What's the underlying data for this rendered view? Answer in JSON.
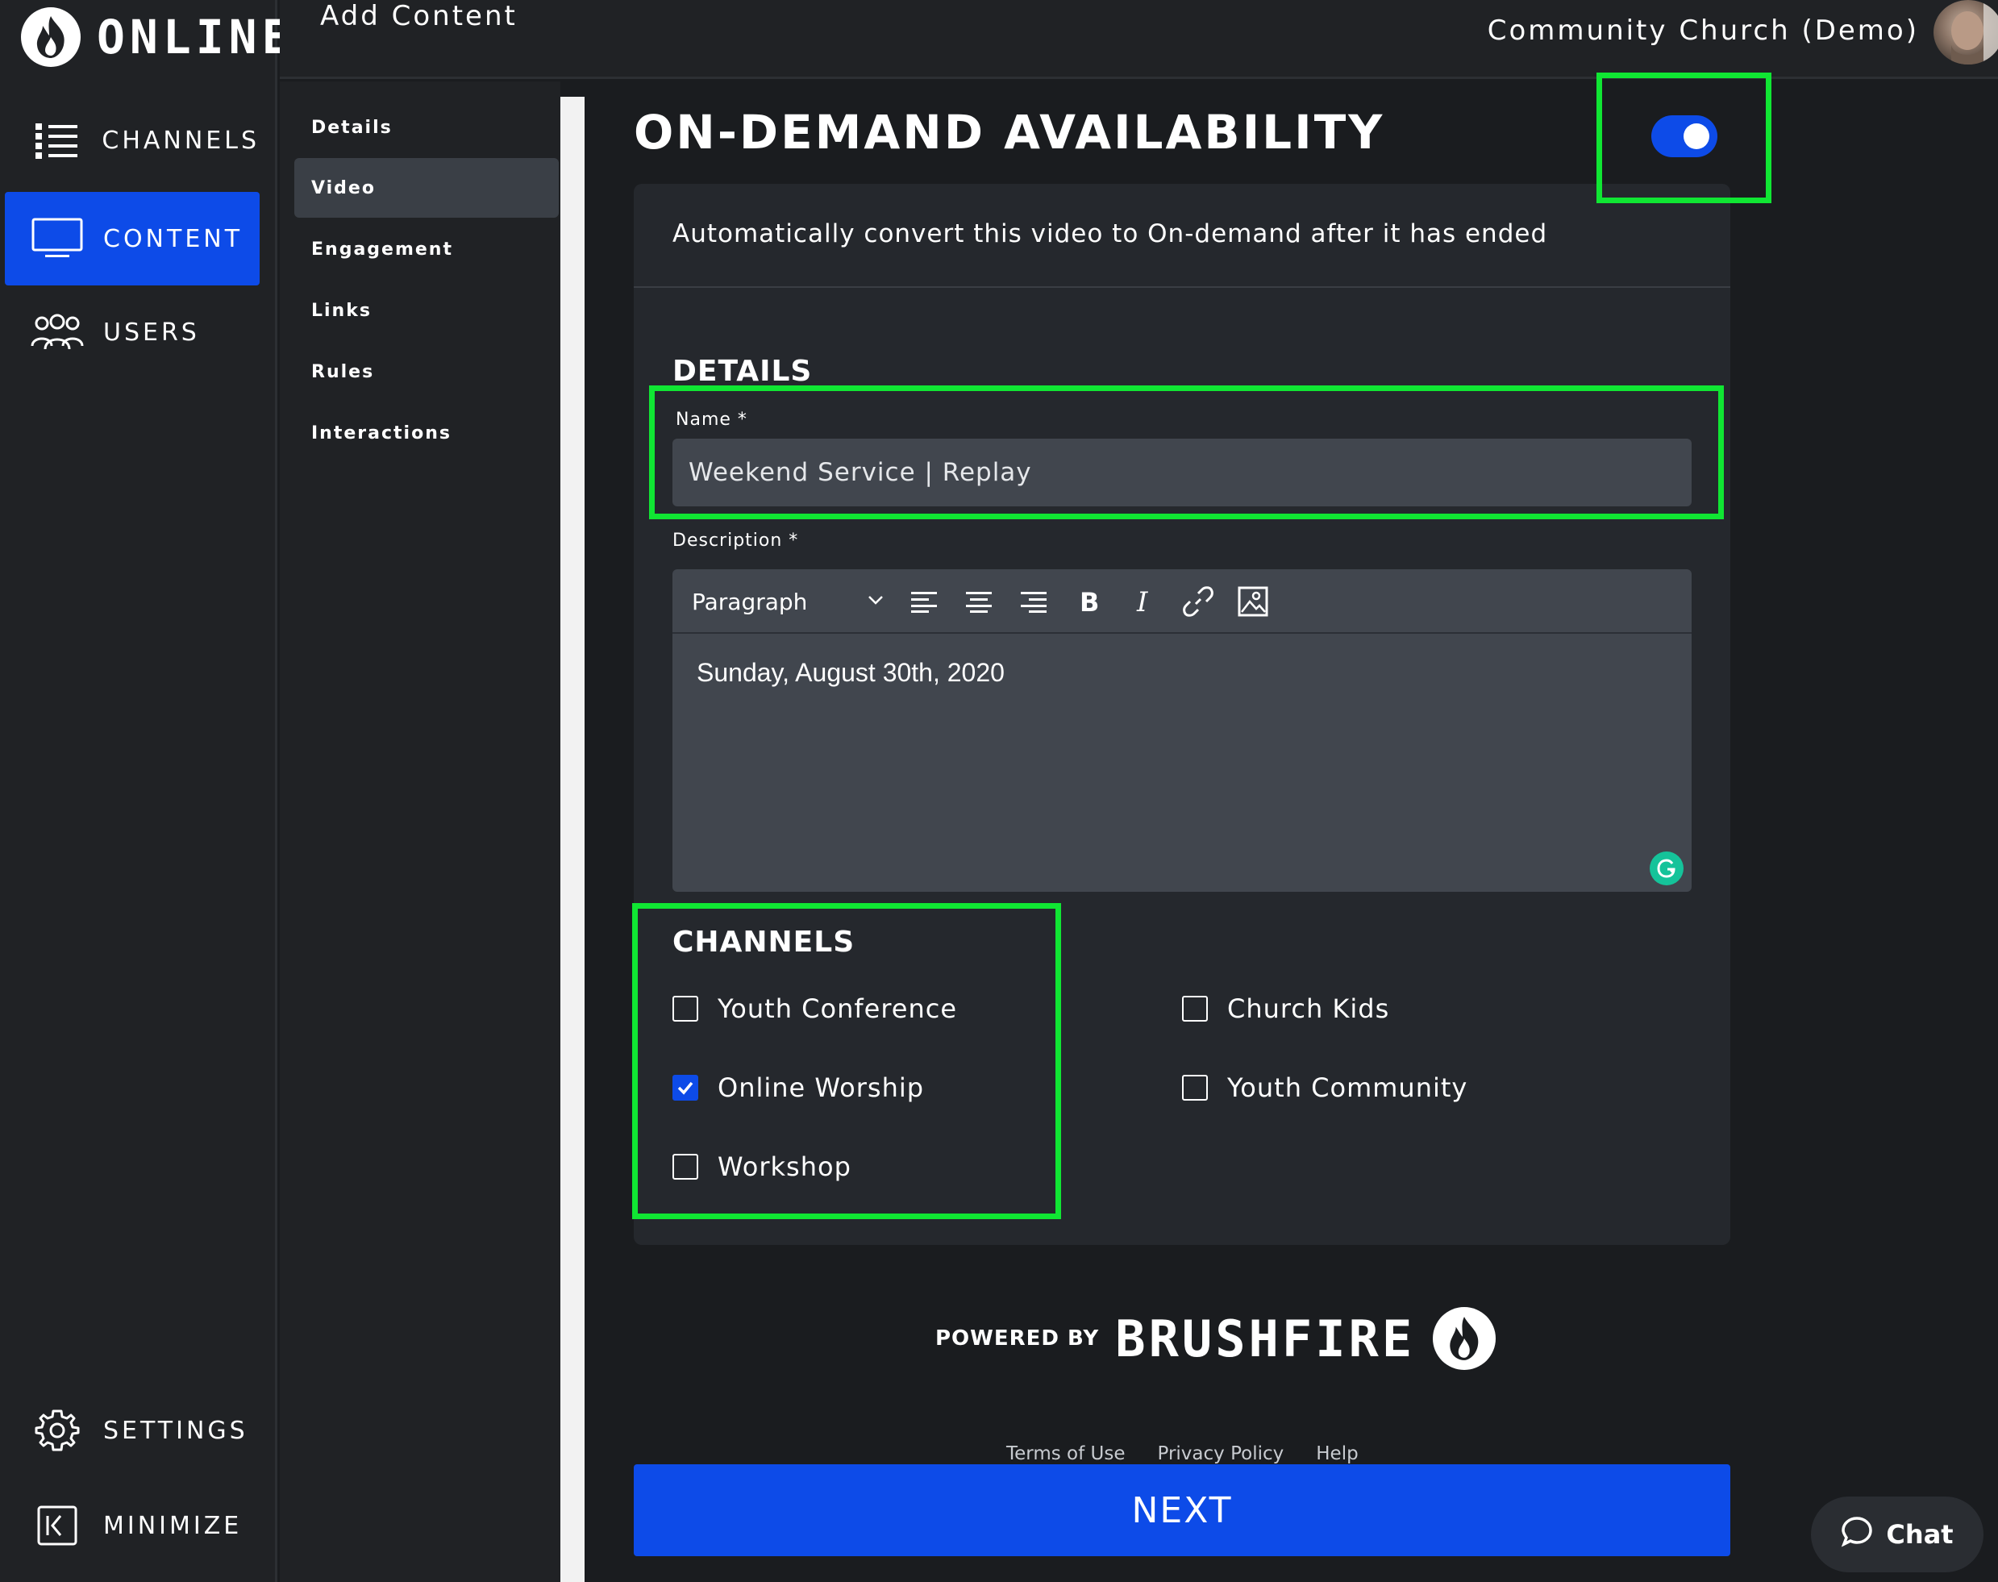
{
  "app": {
    "logo_text": "ONLINE",
    "page_title": "Add Content",
    "org_name": "Community Church (Demo)"
  },
  "nav": {
    "channels": "CHANNELS",
    "content": "CONTENT",
    "users": "USERS",
    "settings": "SETTINGS",
    "minimize": "MINIMIZE",
    "active": "content"
  },
  "subnav": {
    "items": [
      "Details",
      "Video",
      "Engagement",
      "Links",
      "Rules",
      "Interactions"
    ],
    "active": "Video"
  },
  "availability": {
    "title": "ON-DEMAND AVAILABILITY",
    "toggle_on": true,
    "description": "Automatically convert this video to On-demand after it has ended"
  },
  "details": {
    "heading": "DETAILS",
    "name_label": "Name *",
    "name_value": "Weekend Service | Replay",
    "description_label": "Description *",
    "editor": {
      "format_select": "Paragraph",
      "toolbar": [
        "align-left-icon",
        "align-center-icon",
        "align-right-icon",
        "bold-icon",
        "italic-icon",
        "link-icon",
        "image-icon"
      ],
      "content": "Sunday, August 30th, 2020"
    }
  },
  "channels": {
    "heading": "CHANNELS",
    "items": [
      {
        "label": "Youth Conference",
        "checked": false
      },
      {
        "label": "Online Worship",
        "checked": true
      },
      {
        "label": "Workshop",
        "checked": false
      },
      {
        "label": "Church Kids",
        "checked": false
      },
      {
        "label": "Youth Community",
        "checked": false
      }
    ]
  },
  "footer": {
    "powered_by": "POWERED BY",
    "brand": "BRUSHFIRE",
    "links": [
      "Terms of Use",
      "Privacy Policy",
      "Help"
    ],
    "next_label": "NEXT",
    "chat_label": "Chat"
  },
  "colors": {
    "accent": "#0d4be8",
    "highlight": "#10e633",
    "background": "#1a1c1f",
    "panel": "#25282d"
  }
}
